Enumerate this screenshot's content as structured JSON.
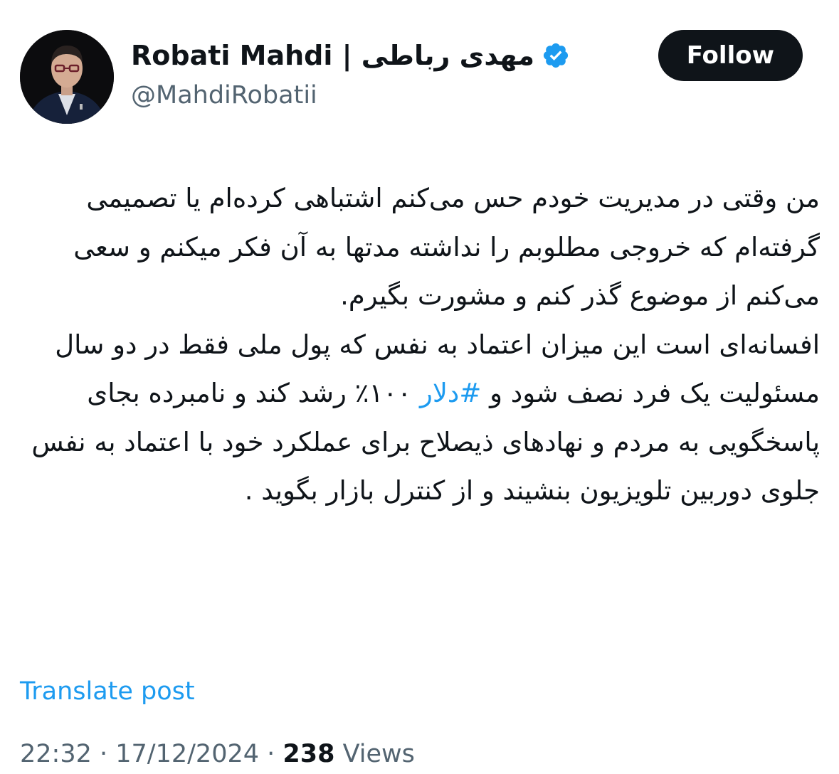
{
  "profile": {
    "display_name": "Robati Mahdi | مهدی رباطی",
    "handle": "@MahdiRobatii",
    "verified_icon": "verified-badge-icon",
    "badge_color": "#1d9bf0"
  },
  "actions": {
    "follow_label": "Follow"
  },
  "tweet": {
    "paragraph1": "من وقتی در مدیریت خودم حس می‌کنم اشتباهی کرده‌ام یا تصمیمی گرفته‌ام که خروجی مطلوبم را نداشته مدتها به آن فکر میکنم و سعی می‌کنم از موضوع گذر کنم و مشورت بگیرم.",
    "paragraph2_before": "افسانه‌ای است این میزان اعتماد به نفس که پول ملی فقط در دو سال مسئولیت یک فرد نصف شود و ",
    "hashtag": "#دلار",
    "paragraph2_after": " ۱۰۰٪ رشد کند و نامبرده بجای پاسخگویی به مردم و نهادهای ذیصلاح برای عملکرد خود با اعتماد به نفس جلوی دوربین تلویزیون بنشیند و از کنترل بازار بگوید ."
  },
  "translate_label": "Translate post",
  "meta": {
    "time": "22:32",
    "separator": " · ",
    "date": "17/12/2024",
    "views_count": "238",
    "views_label": " Views"
  },
  "colors": {
    "accent": "#1d9bf0",
    "text": "#0f1419",
    "muted": "#536471",
    "button_bg": "#0f1419"
  }
}
